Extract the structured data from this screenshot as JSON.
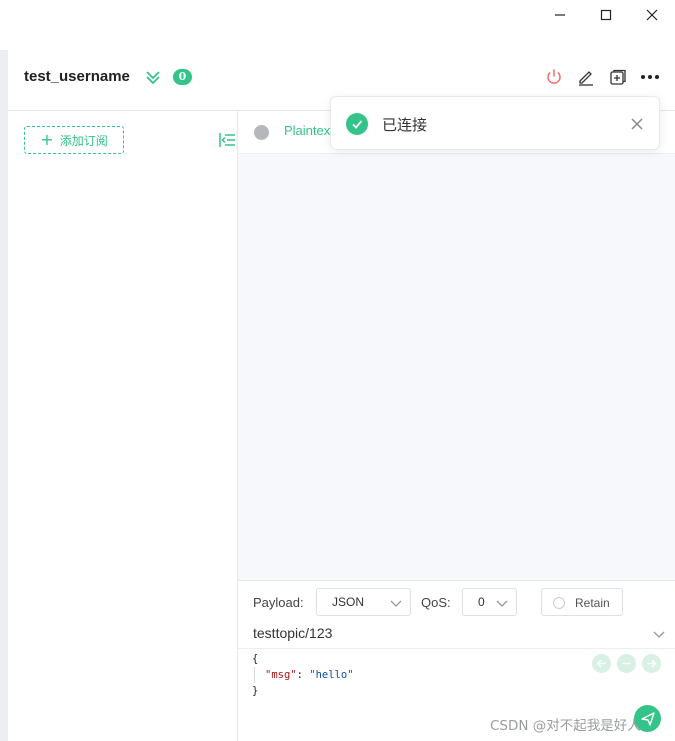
{
  "header": {
    "connection_name": "test_username",
    "message_count": "0"
  },
  "subscriptions": {
    "add_label": "添加订阅"
  },
  "messages": {
    "filter_label": "Plaintex"
  },
  "toast": {
    "text": "已连接"
  },
  "publish": {
    "payload_label": "Payload:",
    "payload_format": "JSON",
    "qos_label": "QoS:",
    "qos_value": "0",
    "retain_label": "Retain",
    "topic": "testtopic/123",
    "payload_open": "{",
    "payload_key": "\"msg\"",
    "payload_colon": ": ",
    "payload_value": "\"hello\"",
    "payload_close": "}"
  },
  "watermark": "CSDN @对不起我是好人",
  "colors": {
    "accent": "#34c388",
    "danger": "#f56c6c",
    "background": "#f7f8fc"
  },
  "icons": [
    "minimize-icon",
    "maximize-icon",
    "close-icon",
    "double-chevron-down-icon",
    "power-icon",
    "edit-icon",
    "new-window-icon",
    "more-icon",
    "plus-icon",
    "collapse-icon",
    "check-icon",
    "chevron-down-icon",
    "arrow-left-icon",
    "minus-icon",
    "arrow-right-icon",
    "send-icon"
  ]
}
